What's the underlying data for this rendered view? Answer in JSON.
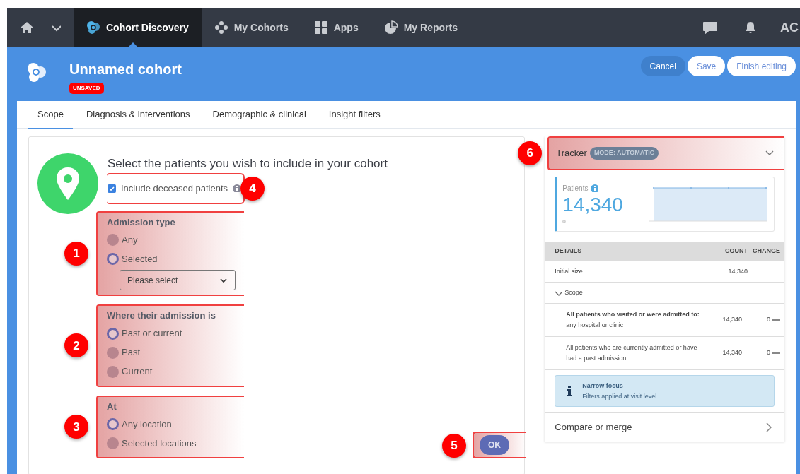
{
  "nav": {
    "items": [
      {
        "kind": "home",
        "selected": false
      },
      {
        "kind": "logo",
        "label": "Cohort Discovery",
        "selected": true
      },
      {
        "kind": "dots",
        "label": "My Cohorts",
        "selected": false
      },
      {
        "kind": "grid",
        "label": "Apps",
        "selected": false
      },
      {
        "kind": "pie",
        "label": "My Reports",
        "selected": false
      }
    ],
    "user": "AC"
  },
  "header": {
    "title": "Unnamed cohort",
    "badge": "UNSAVED",
    "buttons": [
      {
        "label": "Cancel",
        "kind": "dark"
      },
      {
        "label": "Save",
        "kind": "light"
      },
      {
        "label": "Finish editing",
        "kind": "light"
      }
    ]
  },
  "tabs": [
    {
      "label": "Scope",
      "selected": true
    },
    {
      "label": "Diagnosis & interventions",
      "selected": false
    },
    {
      "label": "Demographic & clinical",
      "selected": false
    },
    {
      "label": "Insight filters",
      "selected": false
    }
  ],
  "scope": {
    "heading": "Select the patients you wish to include in your cohort",
    "checkbox": {
      "label": "Include deceased patients",
      "checked": true,
      "callout": "4"
    },
    "groups": [
      {
        "title": "Admission type",
        "callout": "1",
        "options": [
          {
            "label": "Any",
            "selected": false
          },
          {
            "label": "Selected",
            "selected": true
          }
        ],
        "dropdown": {
          "value": "Please select"
        }
      },
      {
        "title": "Where their admission is",
        "callout": "2",
        "options": [
          {
            "label": "Past or current",
            "selected": true
          },
          {
            "label": "Past",
            "selected": false
          },
          {
            "label": "Current",
            "selected": false
          }
        ]
      },
      {
        "title": "At",
        "callout": "3",
        "options": [
          {
            "label": "Any location",
            "selected": true
          },
          {
            "label": "Selected locations",
            "selected": false
          }
        ]
      }
    ],
    "ok_button": {
      "label": "OK",
      "callout": "5"
    }
  },
  "tracker": {
    "title": "Tracker",
    "mode": "MODE: AUTOMATIC",
    "callout": "6",
    "expanded": true,
    "patients_label": "Patients",
    "count": "14,340",
    "axis_min": "0",
    "columns": [
      "DETAILS",
      "COUNT",
      "CHANGE"
    ],
    "rows": [
      {
        "kind": "plain",
        "details": "Initial size",
        "count": "14,340"
      },
      {
        "kind": "section",
        "details": "Scope"
      },
      {
        "kind": "sub",
        "details": "**All patients who visited or were admitted to:** any hospital or clinic",
        "count": "14,340",
        "change": "0"
      },
      {
        "kind": "sub",
        "details": "All patients who are currently admitted or have had a past admission",
        "count": "14,340",
        "change": "0"
      }
    ],
    "info": {
      "title": "Narrow focus",
      "text": "Filters applied at visit level"
    },
    "compare": "Compare or merge"
  }
}
